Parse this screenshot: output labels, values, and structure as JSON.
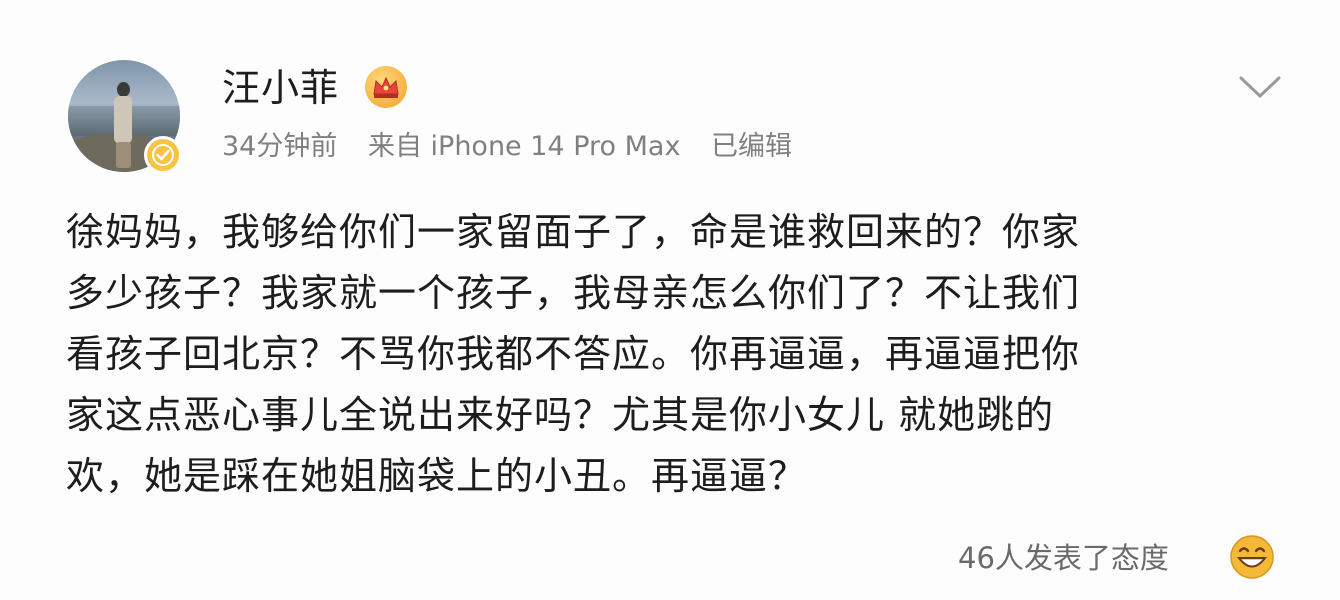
{
  "user": {
    "name": "汪小菲"
  },
  "meta": {
    "time": "34分钟前",
    "source": "来自 iPhone 14 Pro Max",
    "edited": "已编辑"
  },
  "content": {
    "lines": [
      "徐妈妈，我够给你们一家留面子了，命是谁救回来的？你家",
      "多少孩子？我家就一个孩子，我母亲怎么你们了？不让我们",
      "看孩子回北京？不骂你我都不答应。你再逼逼，再逼逼把你",
      "家这点恶心事儿全说出来好吗？尤其是你小女儿 就她跳的",
      "欢，她是踩在她姐脑袋上的小丑。再逼逼？"
    ]
  },
  "footer": {
    "reactions": "46人发表了态度"
  },
  "icons": {
    "verify": "verified-badge-icon",
    "crown": "crown-icon",
    "menu": "chevron-down-icon",
    "reaction": "grin-emoji-icon"
  },
  "colors": {
    "verify_badge": "#f6c343",
    "meta_text": "#808080",
    "emoji": "#f5b938"
  }
}
